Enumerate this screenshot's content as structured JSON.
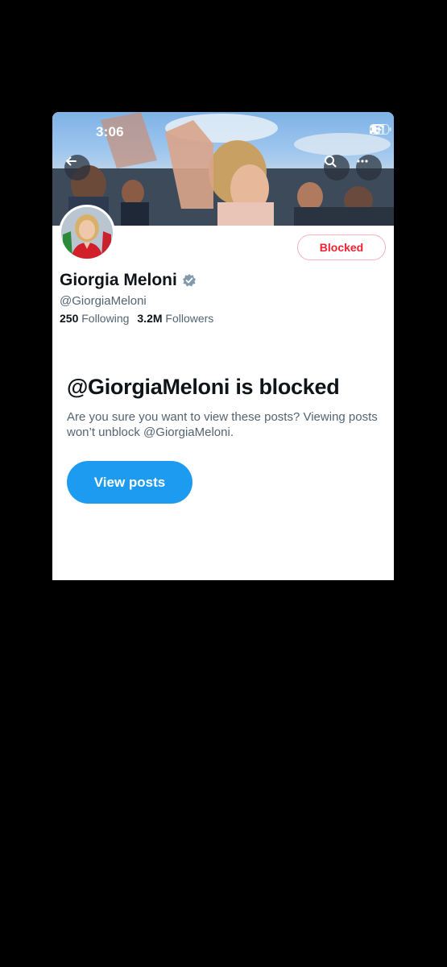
{
  "status_bar": {
    "time": "3:06",
    "icons": [
      "signal-icon",
      "wifi-icon",
      "battery-icon"
    ]
  },
  "header": {
    "back_icon": "arrow-left-icon",
    "search_icon": "search-icon",
    "more_icon": "more-horizontal-icon"
  },
  "profile": {
    "name": "Giorgia Meloni",
    "verified_icon": "verified-badge-icon",
    "handle": "@GiorgiaMeloni",
    "following_count": "250",
    "following_label": "Following",
    "followers_count": "3.2M",
    "followers_label": "Followers",
    "blocked_button_label": "Blocked"
  },
  "blocked_notice": {
    "title": "@GiorgiaMeloni is blocked",
    "description": "Are you sure you want to view these posts? Viewing posts won’t unblock @GiorgiaMeloni.",
    "view_button_label": "View posts"
  },
  "colors": {
    "accent": "#1d9bf0",
    "blocked_red": "#f4212e",
    "text_primary": "#0f1419",
    "text_secondary": "#536471",
    "background": "#000000"
  }
}
